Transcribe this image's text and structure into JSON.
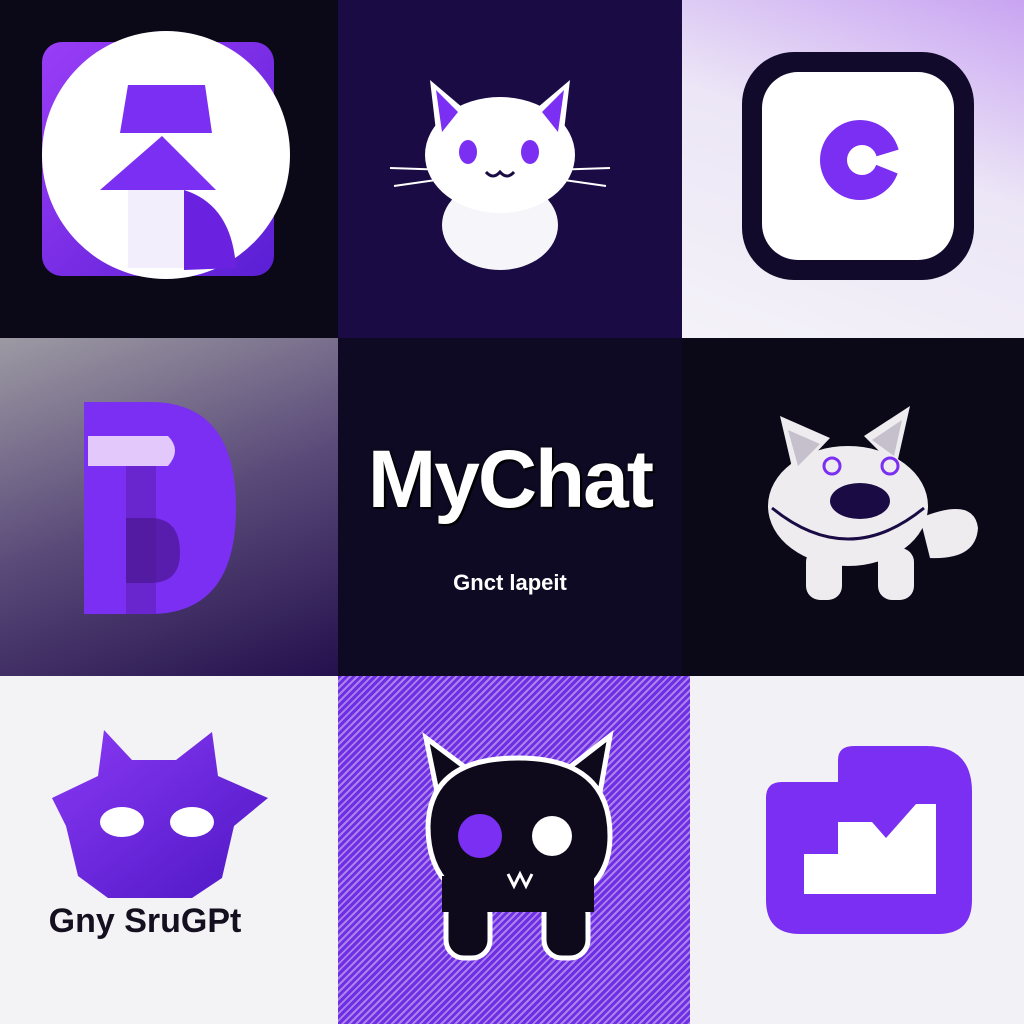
{
  "brand": {
    "title": "MyChat",
    "subtitle": "Gnct lapeit"
  },
  "captions": {
    "bottom_left": "Gny SruGPt"
  },
  "tiles": [
    {
      "id": "lamp-arrow-logo",
      "icon": "lamp-arrow-icon"
    },
    {
      "id": "white-cat-logo",
      "icon": "cat-icon"
    },
    {
      "id": "rounded-c-logo",
      "icon": "c-letter-icon"
    },
    {
      "id": "letter-d-logo",
      "icon": "d-letter-icon"
    },
    {
      "id": "brand-wordmark",
      "icon": "wordmark"
    },
    {
      "id": "round-cat-logo",
      "icon": "cat-icon"
    },
    {
      "id": "purple-mask-logo",
      "icon": "mask-icon"
    },
    {
      "id": "black-cat-logo",
      "icon": "cat-icon"
    },
    {
      "id": "folder-chart-logo",
      "icon": "folder-chart-icon"
    }
  ],
  "colors": {
    "brand_purple": "#7a2ff2",
    "deep_navy": "#1a0b45",
    "near_black": "#0b0818",
    "white": "#ffffff"
  }
}
